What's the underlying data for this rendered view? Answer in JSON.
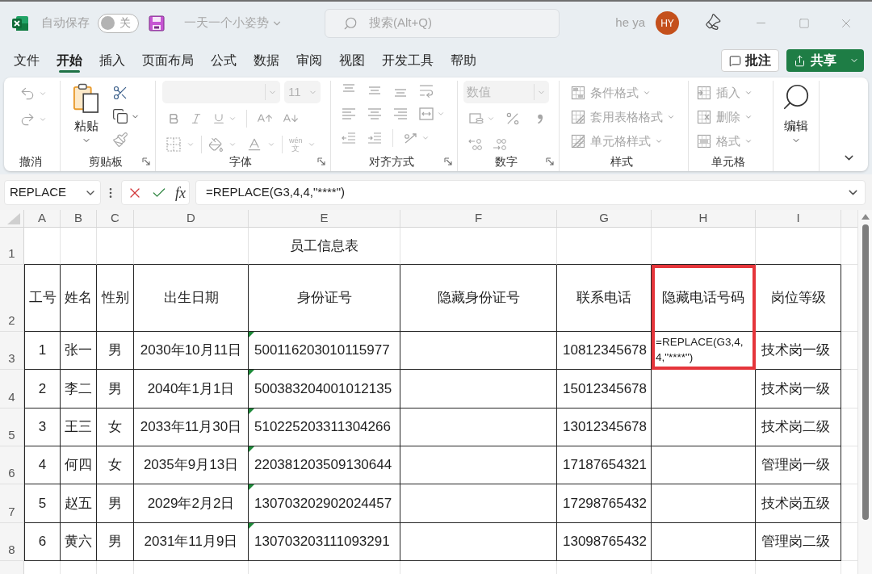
{
  "title_bar": {
    "autosave": {
      "label": "自动保存",
      "on": false,
      "state_label": "关"
    },
    "document_title": "一天一个小姿势",
    "search": {
      "placeholder": "搜索(Alt+Q)"
    },
    "user": {
      "name": "he ya",
      "initials": "HY"
    }
  },
  "menu": {
    "tabs": [
      {
        "label": "文件",
        "selected": false
      },
      {
        "label": "开始",
        "selected": true
      },
      {
        "label": "插入",
        "selected": false
      },
      {
        "label": "页面布局",
        "selected": false
      },
      {
        "label": "公式",
        "selected": false
      },
      {
        "label": "数据",
        "selected": false
      },
      {
        "label": "审阅",
        "selected": false
      },
      {
        "label": "视图",
        "selected": false
      },
      {
        "label": "开发工具",
        "selected": false
      },
      {
        "label": "帮助",
        "selected": false
      }
    ],
    "comments_button": "批注",
    "share_button": "共享"
  },
  "ribbon": {
    "undo": {
      "label": "撤消"
    },
    "clipboard": {
      "label": "剪贴板",
      "paste": "粘贴"
    },
    "font": {
      "label": "字体",
      "size": "11",
      "phonetic_reading": "wén",
      "phonetic_char": "文"
    },
    "alignment": {
      "label": "对齐方式"
    },
    "number": {
      "label": "数字",
      "format": "数值"
    },
    "styles": {
      "label": "样式",
      "commands": [
        {
          "label": "条件格式",
          "disabled": true
        },
        {
          "label": "套用表格格式",
          "disabled": true
        },
        {
          "label": "单元格样式",
          "disabled": true
        }
      ]
    },
    "cells": {
      "label": "单元格",
      "commands": [
        {
          "label": "插入",
          "disabled": true
        },
        {
          "label": "删除",
          "disabled": true
        },
        {
          "label": "格式",
          "disabled": true
        }
      ]
    },
    "editing": {
      "label": "编辑"
    }
  },
  "formula_bar": {
    "name_box": "REPLACE",
    "insert_function": "fx",
    "formula": "=REPLACE(G3,4,4,\"****\")"
  },
  "sheet": {
    "columns": [
      "A",
      "B",
      "C",
      "D",
      "E",
      "F",
      "G",
      "H",
      "I"
    ],
    "title_row": {
      "row": "1",
      "text": "员工信息表"
    },
    "header_row": {
      "row": "2",
      "cells": [
        {
          "label": "工号",
          "highlighted": false
        },
        {
          "label": "姓名",
          "highlighted": false
        },
        {
          "label": "性别",
          "highlighted": false
        },
        {
          "label": "出生日期",
          "highlighted": false
        },
        {
          "label": "身份证号",
          "highlighted": false
        },
        {
          "label": "隐藏身份证号",
          "highlighted": false
        },
        {
          "label": "联系电话",
          "highlighted": false
        },
        {
          "label": "隐藏电话号码",
          "highlighted": true
        },
        {
          "label": "岗位等级",
          "highlighted": false
        }
      ]
    },
    "rows": [
      {
        "row": "3",
        "employee_no": "1",
        "name": "张一",
        "gender": "男",
        "birth_date": "2030年10月11日",
        "id_number": "500116203010115977",
        "id_number_warning": true,
        "phone": "10812345678",
        "hidden_phone": "=REPLACE(G3,4,4,\"****\")",
        "editing": true,
        "position": "技术岗一级"
      },
      {
        "row": "4",
        "employee_no": "2",
        "name": "李二",
        "gender": "男",
        "birth_date": "2040年1月1日",
        "id_number": "500383204001012135",
        "id_number_warning": true,
        "phone": "15012345678",
        "editing": false,
        "position": "技术岗一级"
      },
      {
        "row": "5",
        "employee_no": "3",
        "name": "王三",
        "gender": "女",
        "birth_date": "2033年11月30日",
        "id_number": "510225203311304266",
        "id_number_warning": true,
        "phone": "13012345678",
        "editing": false,
        "position": "技术岗二级"
      },
      {
        "row": "6",
        "employee_no": "4",
        "name": "何四",
        "gender": "女",
        "birth_date": "2035年9月13日",
        "id_number": "220381203509130644",
        "id_number_warning": true,
        "phone": "17187654321",
        "editing": false,
        "position": "管理岗一级"
      },
      {
        "row": "7",
        "employee_no": "5",
        "name": "赵五",
        "gender": "男",
        "birth_date": "2029年2月2日",
        "id_number": "130703202902024457",
        "id_number_warning": true,
        "phone": "17298765432",
        "editing": false,
        "position": "技术岗五级"
      },
      {
        "row": "8",
        "employee_no": "6",
        "name": "黄六",
        "gender": "男",
        "birth_date": "2031年11月9日",
        "id_number": "130703203111093291",
        "id_number_warning": true,
        "phone": "13098765432",
        "editing": false,
        "position": "管理岗二级"
      }
    ]
  }
}
